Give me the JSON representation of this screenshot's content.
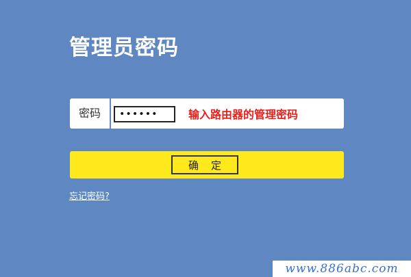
{
  "page": {
    "title": "管理员密码"
  },
  "password": {
    "label": "密码",
    "value": "••••••",
    "hint": "输入路由器的管理密码"
  },
  "confirm": {
    "label": "确定"
  },
  "forgot": {
    "label": "忘记密码?"
  },
  "watermark": {
    "text": "www.886abc.com"
  },
  "colors": {
    "background": "#5f87c2",
    "confirm_bar": "#fde91c",
    "hint": "#e8211b",
    "watermark_text": "#3b6fc9"
  }
}
